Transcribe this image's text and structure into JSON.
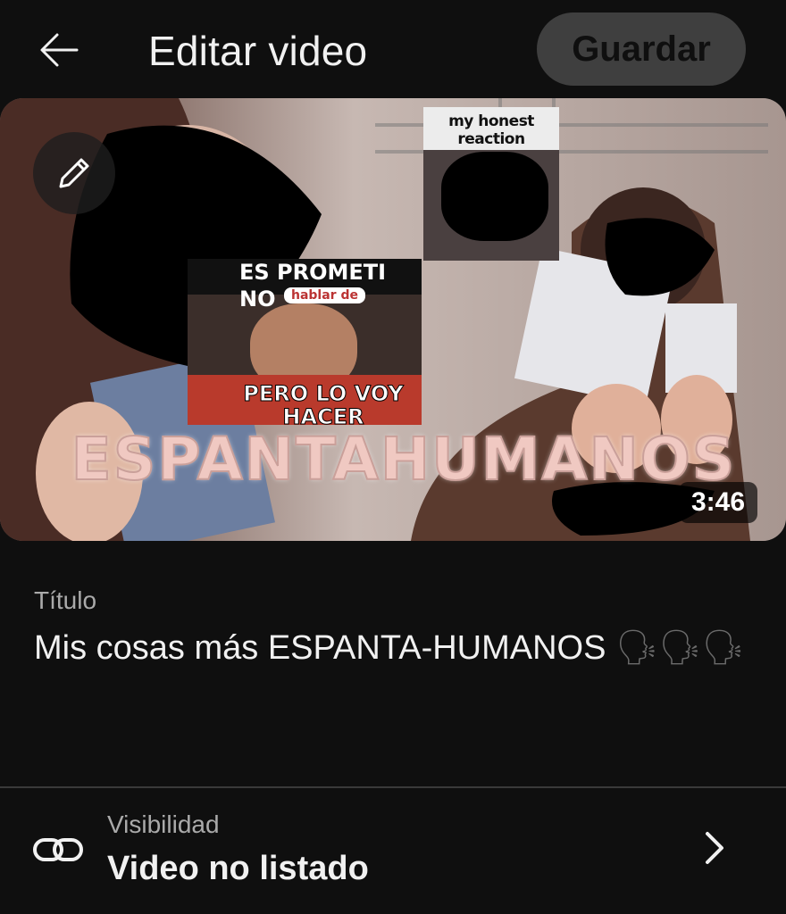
{
  "header": {
    "title": "Editar video",
    "save_label": "Guardar"
  },
  "thumbnail": {
    "duration": "3:46",
    "overlay_text": "ESPANTAHUMANOS",
    "meme_caption_top": "ES PROMETI NO",
    "meme_caption_inline": "hablar de",
    "meme_caption_bottom": "PERO LO VOY HACER",
    "honest_caption": "my honest reaction"
  },
  "title_field": {
    "label": "Título",
    "value": "Mis cosas más ESPANTA-HUMANOS",
    "emoji": "🗣🗣🗣"
  },
  "visibility": {
    "label": "Visibilidad",
    "value": "Video no listado"
  },
  "icons": {
    "back": "arrow-left-icon",
    "edit": "pencil-icon",
    "visibility": "link-icon",
    "chevron": "chevron-right-icon"
  }
}
